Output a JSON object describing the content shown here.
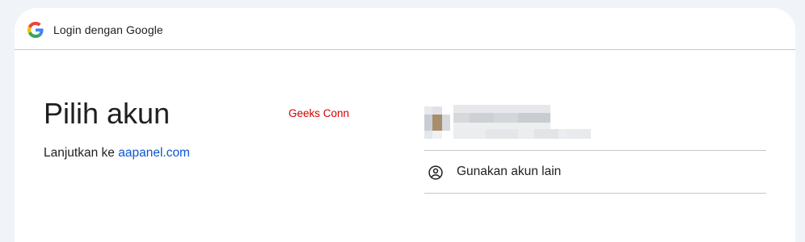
{
  "header": {
    "title": "Login dengan Google",
    "logo_icon": "google-g-icon"
  },
  "main": {
    "title": "Pilih akun",
    "continue_prefix": "Lanjutkan ke",
    "continue_link": "aapanel.com",
    "overlay_label": "Geeks Conn"
  },
  "accounts": {
    "use_other_label": "Gunakan akun lain",
    "use_other_icon": "account-circle-icon"
  },
  "colors": {
    "link": "#0b57d0",
    "overlay_label": "#d20000",
    "background": "#f0f4f9"
  }
}
